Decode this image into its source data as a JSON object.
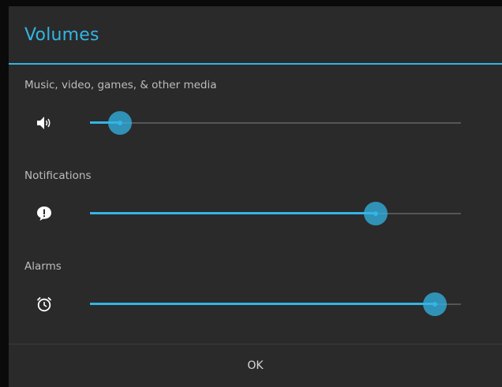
{
  "dialog": {
    "title": "Volumes",
    "ok_label": "OK"
  },
  "rows": [
    {
      "label": "Music, video, games, & other media",
      "icon": "speaker-volume-icon",
      "level": 0.08
    },
    {
      "label": "Notifications",
      "icon": "notification-bubble-icon",
      "level": 0.77
    },
    {
      "label": "Alarms",
      "icon": "alarm-clock-icon",
      "level": 0.93
    }
  ],
  "colors": {
    "accent": "#33b5e5",
    "background": "#2a2a2a",
    "text": "#bdbdbd"
  }
}
